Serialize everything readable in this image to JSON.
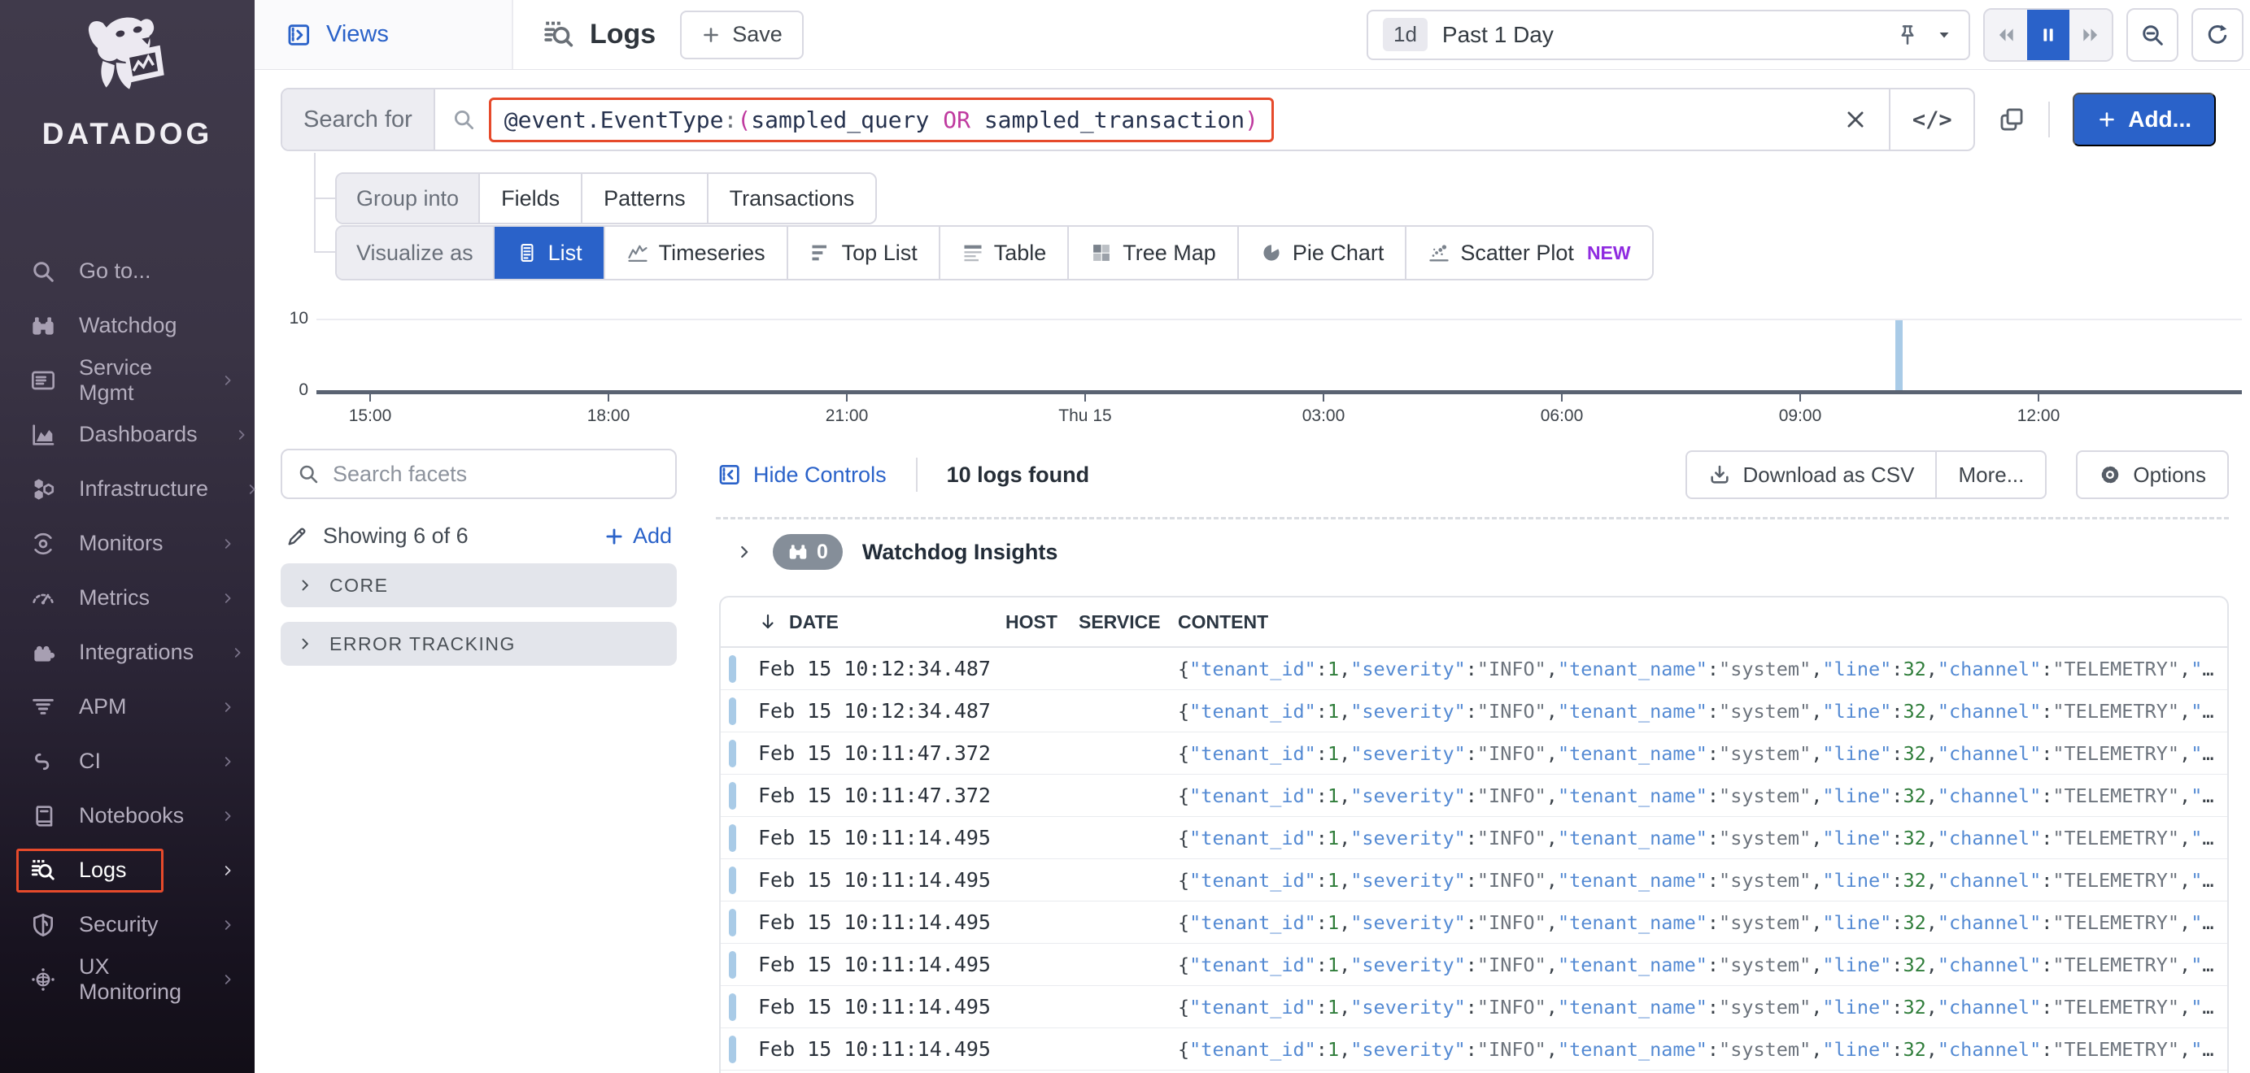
{
  "colors": {
    "accent_blue": "#2a62c9",
    "highlight_red": "#e64a2b",
    "bar_blue": "#a9cbe7",
    "new_purple": "#8f2be0",
    "json_key_blue": "#548ad3",
    "json_num_green": "#2f7d3a",
    "json_str_gray": "#6d747d"
  },
  "sidebar": {
    "brand": "DATADOG",
    "items": [
      {
        "label": "Go to...",
        "icon": "search",
        "expandable": false,
        "active": false
      },
      {
        "label": "Watchdog",
        "icon": "binoculars",
        "expandable": false,
        "active": false
      },
      {
        "label": "Service Mgmt",
        "icon": "service",
        "expandable": true,
        "active": false
      },
      {
        "label": "Dashboards",
        "icon": "dashboards",
        "expandable": true,
        "active": false
      },
      {
        "label": "Infrastructure",
        "icon": "infrastructure",
        "expandable": true,
        "active": false
      },
      {
        "label": "Monitors",
        "icon": "monitors",
        "expandable": true,
        "active": false
      },
      {
        "label": "Metrics",
        "icon": "metrics",
        "expandable": true,
        "active": false
      },
      {
        "label": "Integrations",
        "icon": "integrations",
        "expandable": true,
        "active": false
      },
      {
        "label": "APM",
        "icon": "apm",
        "expandable": true,
        "active": false
      },
      {
        "label": "CI",
        "icon": "ci",
        "expandable": true,
        "active": false
      },
      {
        "label": "Notebooks",
        "icon": "notebooks",
        "expandable": true,
        "active": false
      },
      {
        "label": "Logs",
        "icon": "logs",
        "expandable": true,
        "active": true
      },
      {
        "label": "Security",
        "icon": "security",
        "expandable": true,
        "active": false
      },
      {
        "label": "UX Monitoring",
        "icon": "ux",
        "expandable": true,
        "active": false
      }
    ]
  },
  "header": {
    "views_label": "Views",
    "page_title": "Logs",
    "save_label": "Save",
    "add_label": "Add...",
    "time_range": {
      "badge": "1d",
      "label": "Past 1 Day"
    }
  },
  "search": {
    "label": "Search for",
    "code_glyph": "</>",
    "query_tokens": [
      {
        "t": "@event.EventType",
        "c": "f"
      },
      {
        "t": ":",
        "c": "g"
      },
      {
        "t": "(",
        "c": "m"
      },
      {
        "t": "sampled_query",
        "c": "f"
      },
      {
        "t": " ",
        "c": "g"
      },
      {
        "t": "OR",
        "c": "m"
      },
      {
        "t": " ",
        "c": "g"
      },
      {
        "t": "sampled_transaction",
        "c": "f"
      },
      {
        "t": ")",
        "c": "m"
      }
    ]
  },
  "group_into": {
    "label": "Group into",
    "options": [
      "Fields",
      "Patterns",
      "Transactions"
    ]
  },
  "visualize_as": {
    "label": "Visualize as",
    "options": [
      {
        "label": "List",
        "icon": "list",
        "active": true
      },
      {
        "label": "Timeseries",
        "icon": "timeseries",
        "active": false
      },
      {
        "label": "Top List",
        "icon": "toplist",
        "active": false
      },
      {
        "label": "Table",
        "icon": "tableviz",
        "active": false
      },
      {
        "label": "Tree Map",
        "icon": "treemap",
        "active": false
      },
      {
        "label": "Pie Chart",
        "icon": "pie",
        "active": false
      },
      {
        "label": "Scatter Plot",
        "icon": "scatter",
        "active": false,
        "badge": "NEW"
      }
    ]
  },
  "chart_data": {
    "type": "bar",
    "title": "",
    "x_ticks": [
      "15:00",
      "18:00",
      "21:00",
      "Thu 15",
      "03:00",
      "06:00",
      "09:00",
      "12:00"
    ],
    "y_ticks": [
      "10",
      "0"
    ],
    "ylim": [
      0,
      10
    ],
    "bars": [
      {
        "time": "approx 10:15",
        "value": 10,
        "x_fraction": 0.82
      }
    ],
    "bar_color": "#a9cbe7",
    "legend": "none",
    "grid": "single top gridline at y=10"
  },
  "facets": {
    "placeholder": "Search facets",
    "showing": "Showing 6 of 6",
    "add_label": "Add",
    "groups": [
      "CORE",
      "ERROR TRACKING"
    ]
  },
  "results": {
    "hide_controls_label": "Hide Controls",
    "count_label": "10 logs found",
    "download_label": "Download as CSV",
    "more_label": "More...",
    "options_label": "Options",
    "watchdog": {
      "count": "0",
      "label": "Watchdog Insights"
    }
  },
  "logs_table": {
    "columns": [
      "DATE",
      "HOST",
      "SERVICE",
      "CONTENT"
    ],
    "content_tokens": [
      {
        "t": "{",
        "c": "p"
      },
      {
        "t": "\"tenant_id\"",
        "c": "k"
      },
      {
        "t": ":",
        "c": "p"
      },
      {
        "t": "1",
        "c": "n"
      },
      {
        "t": ",",
        "c": "p"
      },
      {
        "t": "\"severity\"",
        "c": "k"
      },
      {
        "t": ":",
        "c": "p"
      },
      {
        "t": "\"INFO\"",
        "c": "s"
      },
      {
        "t": ",",
        "c": "p"
      },
      {
        "t": "\"tenant_name\"",
        "c": "k"
      },
      {
        "t": ":",
        "c": "p"
      },
      {
        "t": "\"system\"",
        "c": "s"
      },
      {
        "t": ",",
        "c": "p"
      },
      {
        "t": "\"line\"",
        "c": "k"
      },
      {
        "t": ":",
        "c": "p"
      },
      {
        "t": "32",
        "c": "n"
      },
      {
        "t": ",",
        "c": "p"
      },
      {
        "t": "\"channel\"",
        "c": "k"
      },
      {
        "t": ":",
        "c": "p"
      },
      {
        "t": "\"TELEMETRY\"",
        "c": "s"
      },
      {
        "t": ",",
        "c": "p"
      },
      {
        "t": "\"",
        "c": "k"
      },
      {
        "t": "…",
        "c": "p"
      }
    ],
    "rows": [
      {
        "date": "Feb 15 10:12:34.487"
      },
      {
        "date": "Feb 15 10:12:34.487"
      },
      {
        "date": "Feb 15 10:11:47.372"
      },
      {
        "date": "Feb 15 10:11:47.372"
      },
      {
        "date": "Feb 15 10:11:14.495"
      },
      {
        "date": "Feb 15 10:11:14.495"
      },
      {
        "date": "Feb 15 10:11:14.495"
      },
      {
        "date": "Feb 15 10:11:14.495"
      },
      {
        "date": "Feb 15 10:11:14.495"
      },
      {
        "date": "Feb 15 10:11:14.495"
      }
    ]
  }
}
